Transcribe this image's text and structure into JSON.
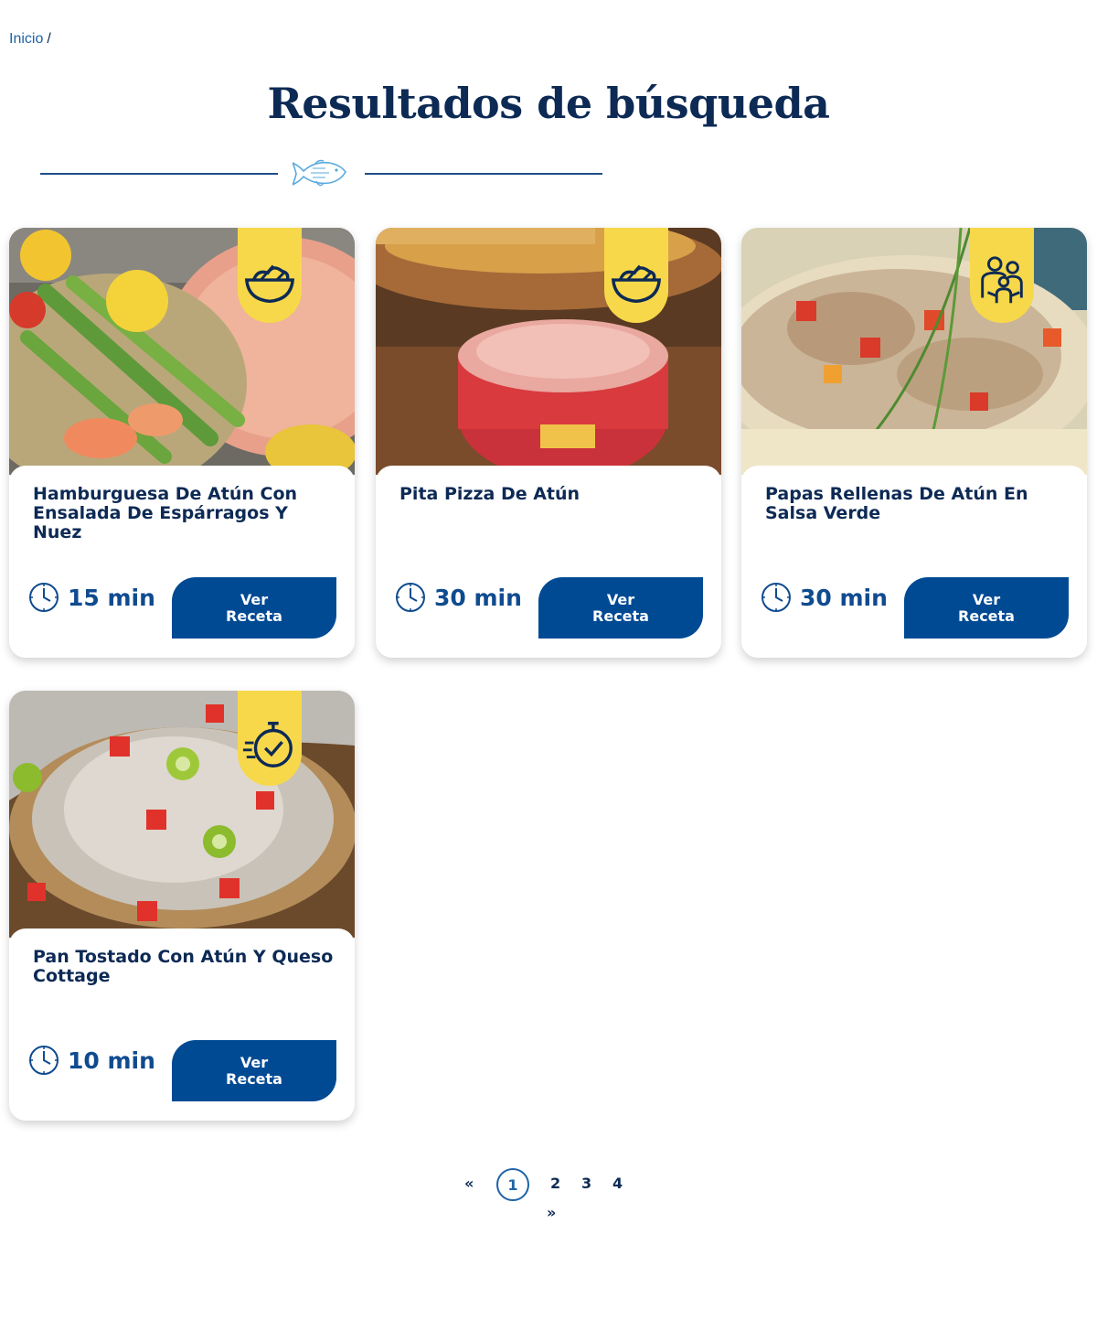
{
  "breadcrumb": {
    "home": "Inicio",
    "separator": "/"
  },
  "page": {
    "title": "Resultados de búsqueda"
  },
  "icons": {
    "divider": "fish-icon",
    "time": "clock-icon"
  },
  "colors": {
    "primary": "#004a94",
    "title": "#0d2a55",
    "badge": "#f7d84a",
    "link": "#1e63a8"
  },
  "recipes": [
    {
      "title": "Hamburguesa De Atún Con Ensalada De Espárragos Y Nuez",
      "time": "15 min",
      "button_line1": "Ver",
      "button_line2": "Receta",
      "badge_icon": "salad-bowl-icon"
    },
    {
      "title": "Pita Pizza De Atún",
      "time": "30 min",
      "button_line1": "Ver",
      "button_line2": "Receta",
      "badge_icon": "salad-bowl-icon"
    },
    {
      "title": "Papas Rellenas De Atún En Salsa Verde",
      "time": "30 min",
      "button_line1": "Ver",
      "button_line2": "Receta",
      "badge_icon": "family-icon"
    },
    {
      "title": "Pan Tostado Con Atún Y Queso Cottage",
      "time": "10 min",
      "button_line1": "Ver",
      "button_line2": "Receta",
      "badge_icon": "stopwatch-check-icon"
    }
  ],
  "pagination": {
    "prev": "«",
    "pages": [
      "1",
      "2",
      "3",
      "4"
    ],
    "current": "1",
    "next": "»"
  }
}
